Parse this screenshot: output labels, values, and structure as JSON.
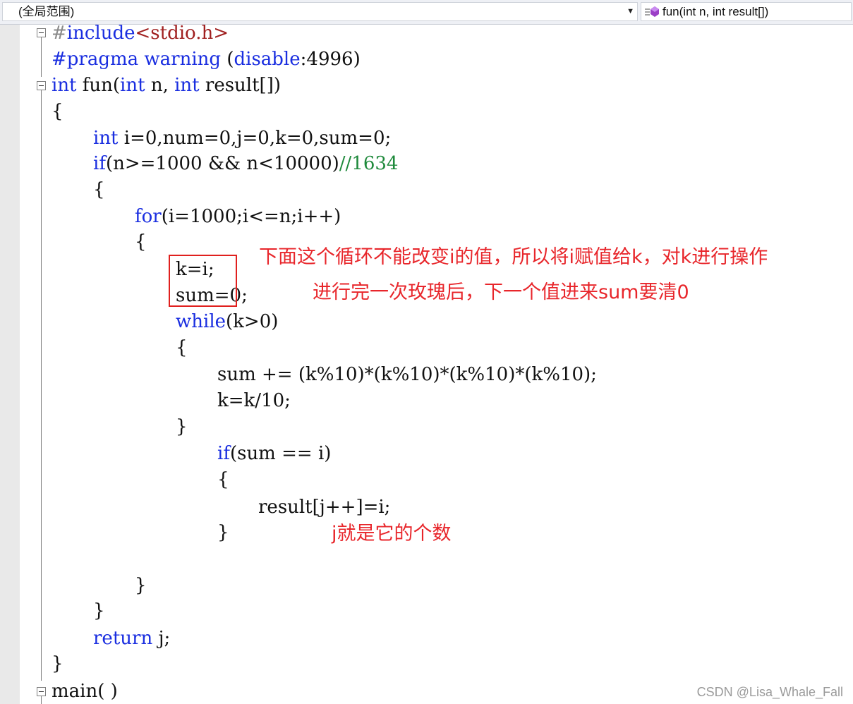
{
  "navbar": {
    "scope": "(全局范围)",
    "function": "fun(int n, int result[])"
  },
  "code": {
    "l01": {
      "hash": "#",
      "pp": "include",
      "inc": "<stdio.h>"
    },
    "l02": {
      "kw": "#pragma warning",
      "rest": " (",
      "kw2": "disable",
      "rest2": ":4996)"
    },
    "l03": {
      "kw1": "int",
      "t1": " fun(",
      "kw2": "int",
      "t2": " n, ",
      "kw3": "int",
      "t3": " result[])"
    },
    "l04": "{",
    "l05": {
      "kw": "int",
      "rest": " i=0,num=0,j=0,k=0,sum=0;"
    },
    "l06": {
      "kw": "if",
      "rest": "(n>=1000 && n<10000)",
      "comment": "//1634"
    },
    "l07": "{",
    "l08": {
      "kw": "for",
      "rest": "(i=1000;i<=n;i++)"
    },
    "l09": "{",
    "l10": "k=i;",
    "l11": "sum=0;",
    "l12": {
      "kw": "while",
      "rest": "(k>0)"
    },
    "l13": "{",
    "l14": "sum += (k%10)*(k%10)*(k%10)*(k%10);",
    "l15": "k=k/10;",
    "l16": "}",
    "l17": {
      "kw": "if",
      "rest": "(sum == i)"
    },
    "l18": "{",
    "l19": "result[j++]=i;",
    "l20": "}",
    "l21": "}",
    "l22": "}",
    "l23": {
      "kw": "return",
      "rest": " j;"
    },
    "l24": "}",
    "l25": "main( )"
  },
  "annotations": {
    "note1": "下面这个循环不能改变i的值，所以将i赋值给k，对k进行操作",
    "note2": "进行完一次玫瑰后，下一个值进来sum要清0",
    "note3": "j就是它的个数"
  },
  "watermark": "CSDN @Lisa_Whale_Fall",
  "colors": {
    "keyword": "#1a2ee0",
    "comment": "#1f8a3c",
    "include_path": "#a02020",
    "annotation": "#e8262b"
  }
}
